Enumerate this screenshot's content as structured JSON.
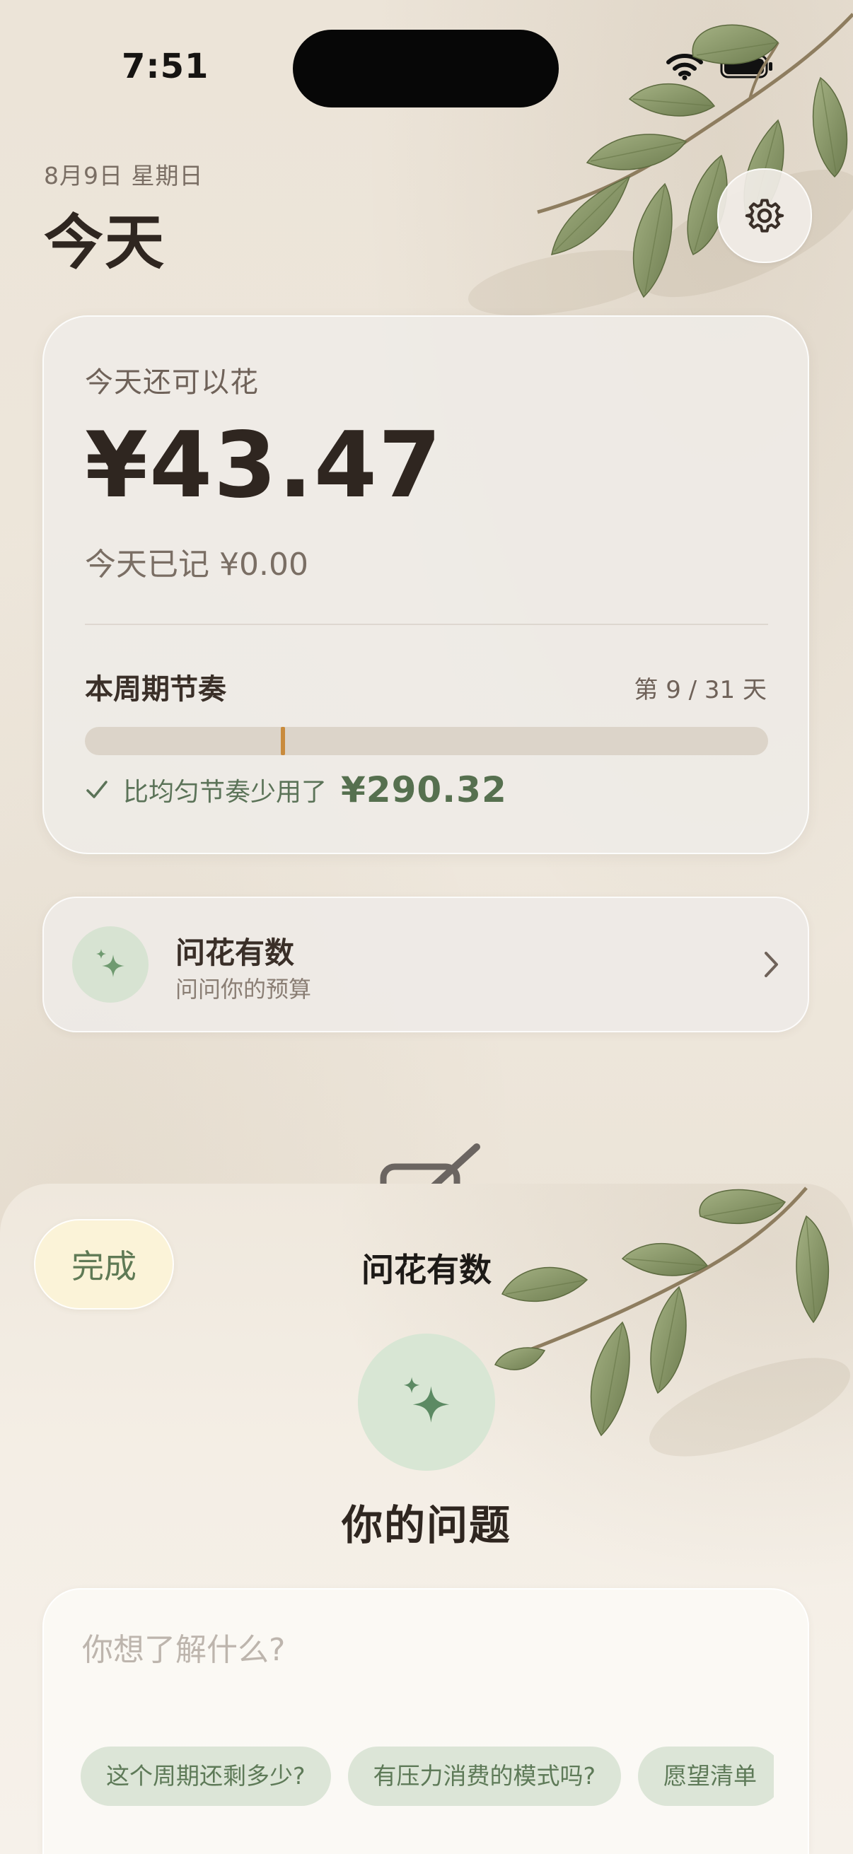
{
  "status_bar": {
    "time": "7:51"
  },
  "header": {
    "date": "8月9日 星期日",
    "title": "今天",
    "settings_icon": "gear-icon"
  },
  "budget_card": {
    "label": "今天还可以花",
    "amount": "¥43.47",
    "recorded_label": "今天已记",
    "recorded_amount": "¥0.00",
    "rhythm_label": "本周期节奏",
    "day_counter": "第 9 / 31 天",
    "progress_fraction": 0.29,
    "pace_text": "比均匀节奏少用了",
    "pace_amount": "¥290.32"
  },
  "ask_card": {
    "title": "问花有数",
    "subtitle": "问问你的预算",
    "icon": "sparkles-icon"
  },
  "sheet": {
    "done_label": "完成",
    "title": "问花有数",
    "icon": "sparkles-icon",
    "heading": "你的问题",
    "input_placeholder": "你想了解什么?",
    "suggestions": [
      "这个周期还剩多少?",
      "有压力消费的模式吗?",
      "愿望清单"
    ]
  },
  "colors": {
    "accent_green": "#5e7a58",
    "progress_marker": "#c98b3d",
    "text_dark": "#2f2620"
  }
}
